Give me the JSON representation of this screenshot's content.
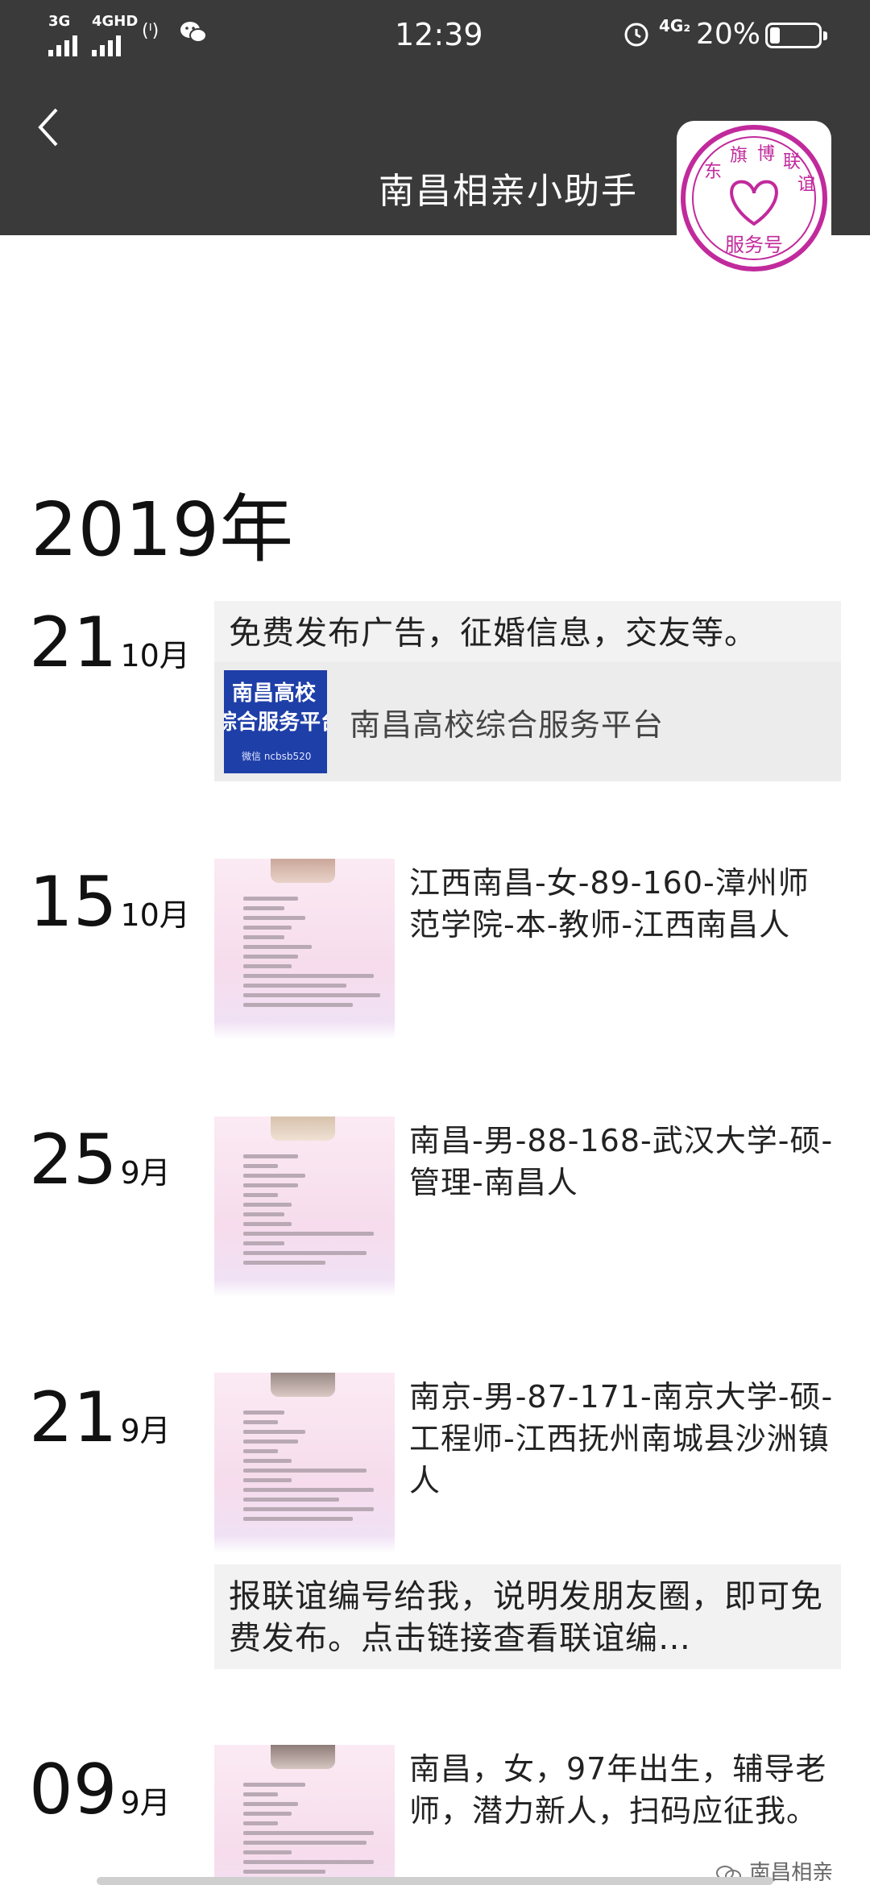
{
  "status_bar": {
    "network1": "3G",
    "network2": "4GHD",
    "wifi_calling": "(ᴵ)",
    "time": "12:39",
    "data_network": "4G₂",
    "battery_percent": "20%",
    "battery_level": 0.2,
    "icons": [
      "signal-icon",
      "wechat-icon",
      "alarm-icon",
      "battery-icon"
    ]
  },
  "header": {
    "title": "南昌相亲小助手",
    "back_icon": "chevron-left-icon",
    "avatar_text": "东 旗 博 联 谊 服务号"
  },
  "timeline": {
    "year": "2019年",
    "entries": [
      {
        "day": "21",
        "month": "10月",
        "text": "免费发布广告，征婚信息，交友等。",
        "link": {
          "thumb_line1": "南昌高校",
          "thumb_line2": "综合服务平台",
          "thumb_line3": "微信 ncbsb520",
          "title": "南昌高校综合服务平台"
        }
      },
      {
        "day": "15",
        "month": "10月",
        "text": "江西南昌-女-89-160-漳州师范学院-本-教师-江西南昌人"
      },
      {
        "day": "25",
        "month": "9月",
        "text": "南昌-男-88-168-武汉大学-硕-管理-南昌人"
      },
      {
        "day": "21",
        "month": "9月",
        "text": "南京-男-87-171-南京大学-硕-工程师-江西抚州南城县沙洲镇人",
        "note": "报联谊编号给我，说明发朋友圈，即可免费发布。点击链接查看联谊编…"
      },
      {
        "day": "09",
        "month": "9月",
        "text": "南昌，女，97年出生，辅导老师，潜力新人，扫码应征我。"
      }
    ]
  },
  "footer": {
    "brand": "南昌相亲"
  },
  "colors": {
    "header_bg": "#3a3a3a",
    "card_bg": "#f2f2f2",
    "accent_pink": "#c12a9c"
  }
}
